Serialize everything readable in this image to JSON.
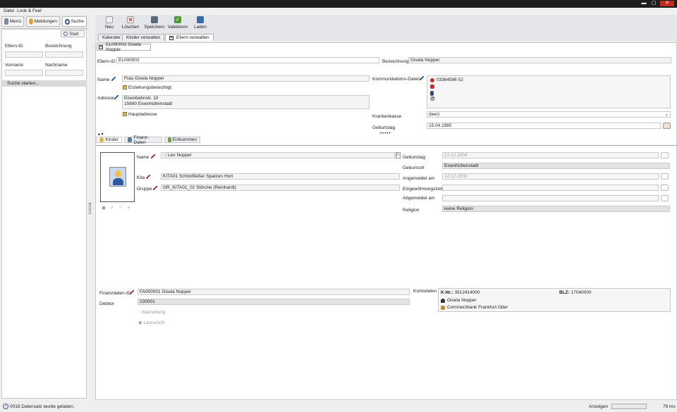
{
  "menu": {
    "items": [
      "Datei",
      "Look & Feel"
    ]
  },
  "left_toolbar": {
    "menu": "Menü",
    "meldungen": "Meldungen",
    "suche": "Suche"
  },
  "search_panel": {
    "start": "Start",
    "eltern_id_label": "Eltern-ID",
    "bezeichnung_label": "Bezeichnung",
    "vorname_label": "Vorname",
    "nachname_label": "Nachname",
    "suche_starten": "Suche starten..."
  },
  "toolbar": {
    "neu": "Neu",
    "loeschen": "Löschen",
    "speichern": "Speichern",
    "validieren": "Validieren",
    "laden": "Laden"
  },
  "tabs": [
    "Kalender",
    "Kinder verwalten",
    "Eltern verwalten"
  ],
  "record_tab": "EL000002 Gisela Nopper",
  "form": {
    "eltern_id_label": "Eltern-ID",
    "eltern_id": "EL000002",
    "bezeichnung_label": "Bezeichnung",
    "bezeichnung": "Gisela Nopper",
    "name_label": "Name",
    "name": "Frau Gisela Nopper",
    "erziehungsberechtigt": "Erziehungsberechtigt",
    "adresse_label": "Adresse",
    "adresse_line1": "Eisenbahnstr. 10",
    "adresse_line2": "15890 Eisenhüttenstadt",
    "hauptadresse": "Hauptadresse",
    "komm_label": "Kommunikations-Daten",
    "telefon": "03364596 52",
    "krankenkasse_label": "Krankenkasse",
    "krankenkasse": "(leer)",
    "geburtstag_label": "Geburtstag",
    "geburtstag": "15.04.1980"
  },
  "subtabs": [
    "Kinder",
    "Finanz-Daten",
    "Einkommen"
  ],
  "kind": {
    "name_label": "Name",
    "name": "Leo Nopper",
    "kita_label": "Kita",
    "kita": "KITA01 Schönfließer Spatzen Hort",
    "gruppe_label": "Gruppe",
    "gruppe": "GR_KITA01_02 Störche (Reinhardt)",
    "geburtstag_label": "Geburtstag",
    "geburtstag": "12.12.2004",
    "geburtsort_label": "Geburtsort",
    "geburtsort": "Eisenhüttenstadt",
    "angemeldet_label": "Angemeldet am",
    "angemeldet": "12.12.2003",
    "eingewoehnung_label": "Eingewöhnungszeit",
    "abgemeldet_label": "Abgemeldet am",
    "religion_label": "Religion",
    "religion": "keine Religion"
  },
  "finanz": {
    "finanzdaten_label": "Finanzdaten-ID",
    "finanzdaten": "FA000001 Gisela Nopper",
    "debitor_label": "Debitor",
    "debitor": "100001",
    "barzahlung": "Barzahlung",
    "lastschrift": "Lastschrift",
    "kontodaten_label": "Kontodaten",
    "knr_label": "K-Nr.:",
    "knr": "3512414000",
    "blz_label": "BLZ:",
    "blz": "17040000",
    "inhaber": "Gisela Nopper",
    "bank": "Commerzbank Frankfurt Oder"
  },
  "status": {
    "message": "0018 Datensatz wurde geladen.",
    "anzeigen": "Anzeigen",
    "time": "79 ms"
  },
  "colors": {
    "titlebar": "#1e1e1e",
    "pen_blue": "#1f4fa5",
    "pen_red": "#b32020",
    "accent_gold": "#f5d27a"
  }
}
